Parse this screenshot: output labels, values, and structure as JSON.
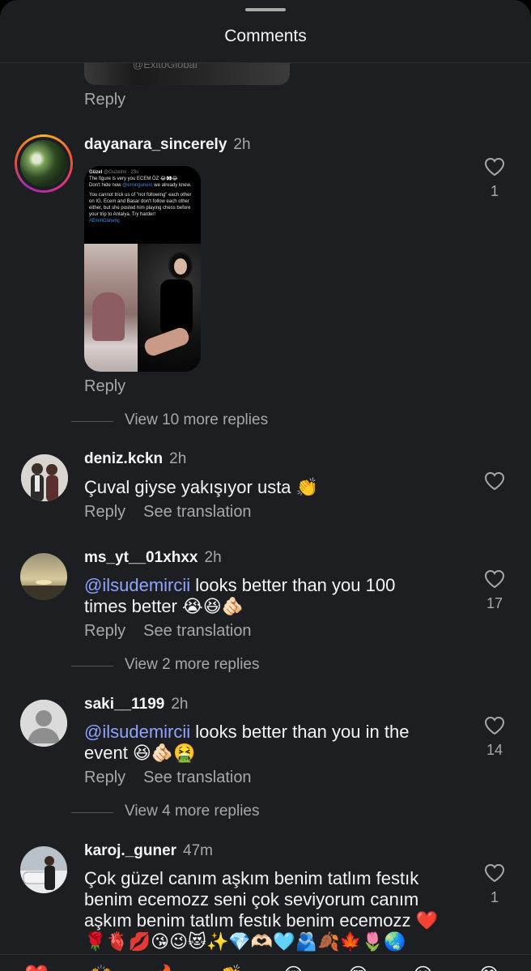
{
  "sheet": {
    "title": "Comments"
  },
  "previous": {
    "image_caption": "@ExitoGlobal",
    "reply_label": "Reply"
  },
  "comments": [
    {
      "username": "dayanara_sincerely",
      "time": "2h",
      "reply_label": "Reply",
      "likes": "1",
      "view_more": "View 10 more replies",
      "attachment": {
        "tweet_author": "Güzel",
        "tweet_handle": "@Guzelmi · 23s",
        "tweet_line1": "The figure is very you ECEM ÖZ 😂👀😂",
        "tweet_line2_prefix": "Don't hide now ",
        "tweet_line2_mention": "@emingunerc",
        "tweet_line2_suffix": " we already knew.",
        "tweet_line3": "You cannot trick us of \"not following\" each other on IG. Ecem and Basar don't follow each other either, but she posted him playing chess before your trip to Antalya. Try harder!",
        "tweet_tag": "#EminGünenç"
      }
    },
    {
      "username": "deniz.kckn",
      "time": "2h",
      "text": "Çuval giyse yakışıyor usta 👏",
      "reply_label": "Reply",
      "translate_label": "See translation"
    },
    {
      "username": "ms_yt__01xhxx",
      "time": "2h",
      "mention": "@ilsudemircii",
      "text": " looks better than you 100 times better 😭😆🫵🏻",
      "reply_label": "Reply",
      "translate_label": "See translation",
      "likes": "17",
      "view_more": "View 2 more replies"
    },
    {
      "username": "saki__1199",
      "time": "2h",
      "mention": "@ilsudemircii",
      "text": " looks better than you in the event 😆🫵🏻🤮",
      "reply_label": "Reply",
      "translate_label": "See translation",
      "likes": "14",
      "view_more": "View 4 more replies"
    },
    {
      "username": "karoj._guner",
      "time": "47m",
      "text": "Çok güzel canım aşkım benim tatlım festık benim ecemozz seni çok seviyorum canım aşkım benim tatlım festık benim ecemozz ❤️ 🌹🫀💋😘😉😻✨💎🫶🏻🩵🫂🍂🍁🌷🌏",
      "likes": "1"
    }
  ],
  "emoji_bar": [
    "❤️",
    "🙌",
    "🔥",
    "👏",
    "😢",
    "😍",
    "😮",
    "😂"
  ],
  "colors": {
    "background": "#1c1e21",
    "text": "#f5f5f5",
    "secondary": "#a8a8a8",
    "mention": "#8fa4ff"
  }
}
